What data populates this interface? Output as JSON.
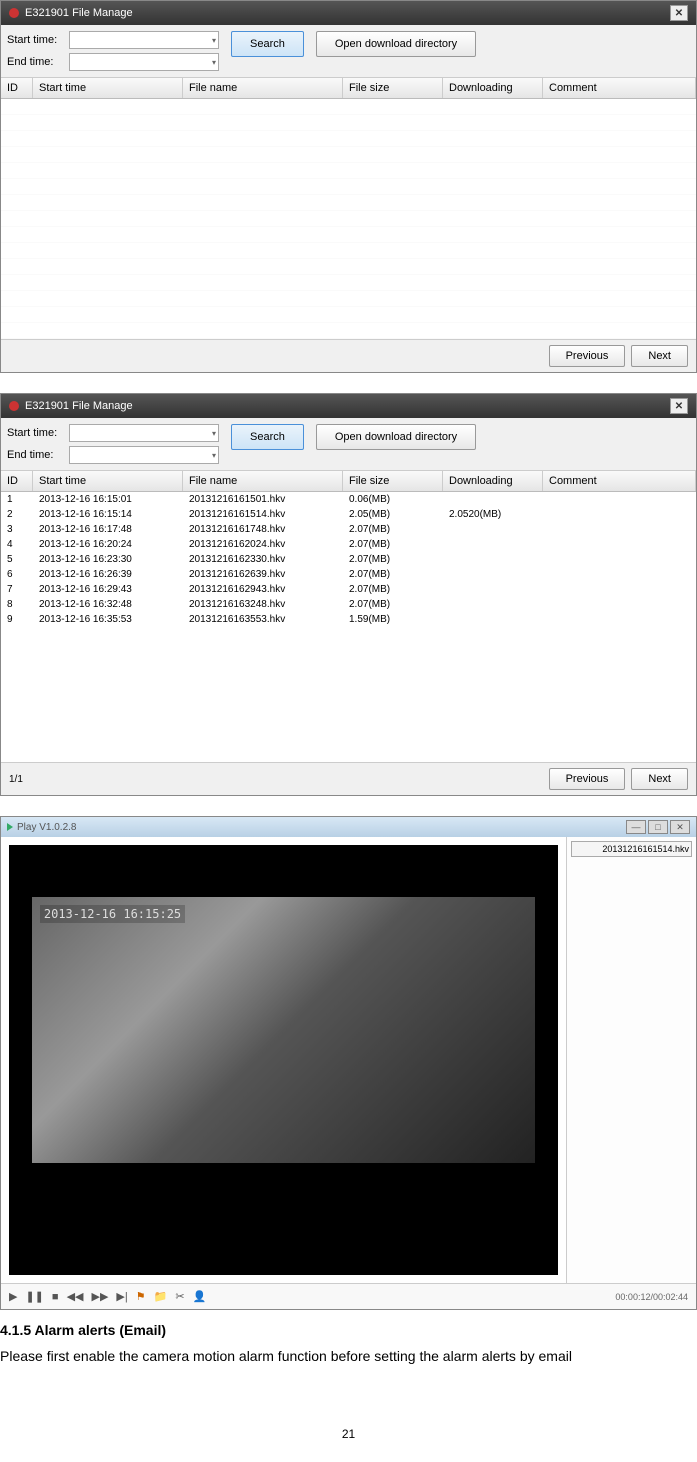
{
  "window1": {
    "title": "E321901 File Manage",
    "start_label": "Start time:",
    "end_label": "End time:",
    "search_btn": "Search",
    "open_btn": "Open download directory",
    "cols": {
      "id": "ID",
      "start": "Start time",
      "fname": "File name",
      "fsize": "File size",
      "dl": "Downloading",
      "comment": "Comment"
    },
    "prev": "Previous",
    "next": "Next"
  },
  "window2": {
    "title": "E321901 File Manage",
    "start_label": "Start time:",
    "end_label": "End time:",
    "search_btn": "Search",
    "open_btn": "Open download directory",
    "cols": {
      "id": "ID",
      "start": "Start time",
      "fname": "File name",
      "fsize": "File size",
      "dl": "Downloading",
      "comment": "Comment"
    },
    "rows": [
      {
        "id": "1",
        "start": "2013-12-16 16:15:01",
        "fname": "20131216161501.hkv",
        "fsize": "0.06(MB)",
        "dl": ""
      },
      {
        "id": "2",
        "start": "2013-12-16 16:15:14",
        "fname": "20131216161514.hkv",
        "fsize": "2.05(MB)",
        "dl": "2.0520(MB)"
      },
      {
        "id": "3",
        "start": "2013-12-16 16:17:48",
        "fname": "20131216161748.hkv",
        "fsize": "2.07(MB)",
        "dl": ""
      },
      {
        "id": "4",
        "start": "2013-12-16 16:20:24",
        "fname": "20131216162024.hkv",
        "fsize": "2.07(MB)",
        "dl": ""
      },
      {
        "id": "5",
        "start": "2013-12-16 16:23:30",
        "fname": "20131216162330.hkv",
        "fsize": "2.07(MB)",
        "dl": ""
      },
      {
        "id": "6",
        "start": "2013-12-16 16:26:39",
        "fname": "20131216162639.hkv",
        "fsize": "2.07(MB)",
        "dl": ""
      },
      {
        "id": "7",
        "start": "2013-12-16 16:29:43",
        "fname": "20131216162943.hkv",
        "fsize": "2.07(MB)",
        "dl": ""
      },
      {
        "id": "8",
        "start": "2013-12-16 16:32:48",
        "fname": "20131216163248.hkv",
        "fsize": "2.07(MB)",
        "dl": ""
      },
      {
        "id": "9",
        "start": "2013-12-16 16:35:53",
        "fname": "20131216163553.hkv",
        "fsize": "1.59(MB)",
        "dl": ""
      }
    ],
    "page_info": "1/1",
    "prev": "Previous",
    "next": "Next"
  },
  "player": {
    "title": "Play V1.0.2.8",
    "side_file": "20131216161514.hkv",
    "timestamp": "2013-12-16 16:15:25",
    "timecode": "00:00:12/00:02:44"
  },
  "doc": {
    "heading": "4.1.5 Alarm alerts (Email)",
    "body": "Please first enable the camera motion alarm function before setting the alarm alerts by email",
    "page": "21"
  }
}
